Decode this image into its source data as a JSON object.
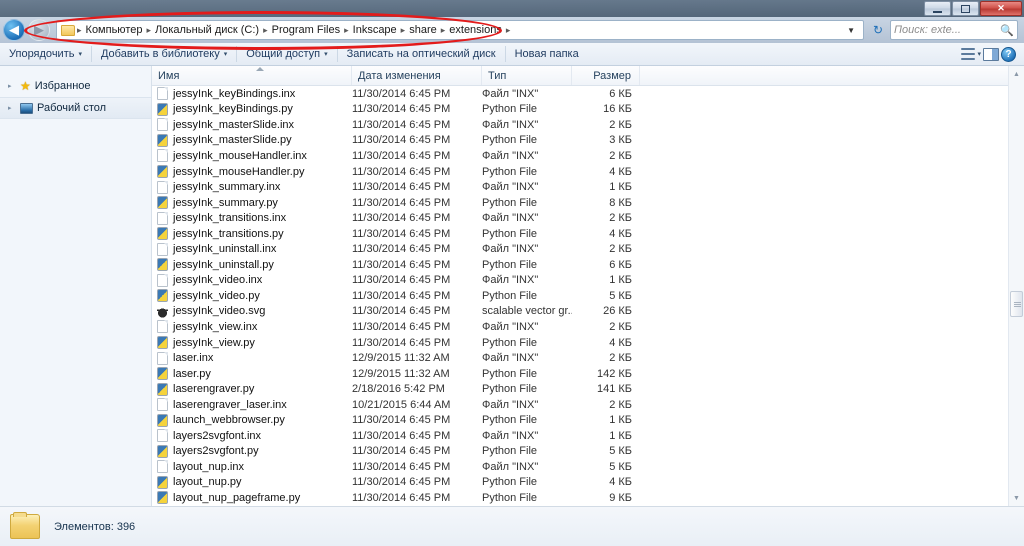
{
  "window": {
    "controls": {
      "minimize": "–",
      "maximize": "❐",
      "close": "✕"
    }
  },
  "address": {
    "back_label": "◀",
    "forward_label": "▶",
    "breadcrumbs": [
      "Компьютер",
      "Локальный диск (C:)",
      "Program Files",
      "Inkscape",
      "share",
      "extensions"
    ],
    "separator": "▸",
    "dropdown": "▼",
    "refresh": "↻"
  },
  "search": {
    "placeholder": "Поиск: exte...",
    "value": "",
    "icon": "search-icon"
  },
  "toolbar": {
    "organize": "Упорядочить",
    "add_to_library": "Добавить в библиотеку",
    "share": "Общий доступ",
    "burn": "Записать на оптический диск",
    "new_folder": "Новая папка",
    "caret": "▾",
    "help": "?"
  },
  "sidebar": {
    "items": [
      {
        "label": "Избранное",
        "icon": "star-icon",
        "expander": "▸"
      },
      {
        "label": "Рабочий стол",
        "icon": "desktop-icon",
        "expander": "▸"
      }
    ]
  },
  "columns": {
    "name": "Имя",
    "date": "Дата изменения",
    "type": "Тип",
    "size": "Размер"
  },
  "files": [
    {
      "name": "jessyInk_keyBindings.inx",
      "date": "11/30/2014 6:45 PM",
      "type": "Файл \"INX\"",
      "size": "6 КБ",
      "icon": "doc"
    },
    {
      "name": "jessyInk_keyBindings.py",
      "date": "11/30/2014 6:45 PM",
      "type": "Python File",
      "size": "16 КБ",
      "icon": "py"
    },
    {
      "name": "jessyInk_masterSlide.inx",
      "date": "11/30/2014 6:45 PM",
      "type": "Файл \"INX\"",
      "size": "2 КБ",
      "icon": "doc"
    },
    {
      "name": "jessyInk_masterSlide.py",
      "date": "11/30/2014 6:45 PM",
      "type": "Python File",
      "size": "3 КБ",
      "icon": "py"
    },
    {
      "name": "jessyInk_mouseHandler.inx",
      "date": "11/30/2014 6:45 PM",
      "type": "Файл \"INX\"",
      "size": "2 КБ",
      "icon": "doc"
    },
    {
      "name": "jessyInk_mouseHandler.py",
      "date": "11/30/2014 6:45 PM",
      "type": "Python File",
      "size": "4 КБ",
      "icon": "py"
    },
    {
      "name": "jessyInk_summary.inx",
      "date": "11/30/2014 6:45 PM",
      "type": "Файл \"INX\"",
      "size": "1 КБ",
      "icon": "doc"
    },
    {
      "name": "jessyInk_summary.py",
      "date": "11/30/2014 6:45 PM",
      "type": "Python File",
      "size": "8 КБ",
      "icon": "py"
    },
    {
      "name": "jessyInk_transitions.inx",
      "date": "11/30/2014 6:45 PM",
      "type": "Файл \"INX\"",
      "size": "2 КБ",
      "icon": "doc"
    },
    {
      "name": "jessyInk_transitions.py",
      "date": "11/30/2014 6:45 PM",
      "type": "Python File",
      "size": "4 КБ",
      "icon": "py"
    },
    {
      "name": "jessyInk_uninstall.inx",
      "date": "11/30/2014 6:45 PM",
      "type": "Файл \"INX\"",
      "size": "2 КБ",
      "icon": "doc"
    },
    {
      "name": "jessyInk_uninstall.py",
      "date": "11/30/2014 6:45 PM",
      "type": "Python File",
      "size": "6 КБ",
      "icon": "py"
    },
    {
      "name": "jessyInk_video.inx",
      "date": "11/30/2014 6:45 PM",
      "type": "Файл \"INX\"",
      "size": "1 КБ",
      "icon": "doc"
    },
    {
      "name": "jessyInk_video.py",
      "date": "11/30/2014 6:45 PM",
      "type": "Python File",
      "size": "5 КБ",
      "icon": "py"
    },
    {
      "name": "jessyInk_video.svg",
      "date": "11/30/2014 6:45 PM",
      "type": "scalable vector gr...",
      "size": "26 КБ",
      "icon": "svg"
    },
    {
      "name": "jessyInk_view.inx",
      "date": "11/30/2014 6:45 PM",
      "type": "Файл \"INX\"",
      "size": "2 КБ",
      "icon": "doc"
    },
    {
      "name": "jessyInk_view.py",
      "date": "11/30/2014 6:45 PM",
      "type": "Python File",
      "size": "4 КБ",
      "icon": "py"
    },
    {
      "name": "laser.inx",
      "date": "12/9/2015 11:32 AM",
      "type": "Файл \"INX\"",
      "size": "2 КБ",
      "icon": "doc"
    },
    {
      "name": "laser.py",
      "date": "12/9/2015 11:32 AM",
      "type": "Python File",
      "size": "142 КБ",
      "icon": "py"
    },
    {
      "name": "laserengraver.py",
      "date": "2/18/2016 5:42 PM",
      "type": "Python File",
      "size": "141 КБ",
      "icon": "py"
    },
    {
      "name": "laserengraver_laser.inx",
      "date": "10/21/2015 6:44 AM",
      "type": "Файл \"INX\"",
      "size": "2 КБ",
      "icon": "doc"
    },
    {
      "name": "launch_webbrowser.py",
      "date": "11/30/2014 6:45 PM",
      "type": "Python File",
      "size": "1 КБ",
      "icon": "py"
    },
    {
      "name": "layers2svgfont.inx",
      "date": "11/30/2014 6:45 PM",
      "type": "Файл \"INX\"",
      "size": "1 КБ",
      "icon": "doc"
    },
    {
      "name": "layers2svgfont.py",
      "date": "11/30/2014 6:45 PM",
      "type": "Python File",
      "size": "5 КБ",
      "icon": "py"
    },
    {
      "name": "layout_nup.inx",
      "date": "11/30/2014 6:45 PM",
      "type": "Файл \"INX\"",
      "size": "5 КБ",
      "icon": "doc"
    },
    {
      "name": "layout_nup.py",
      "date": "11/30/2014 6:45 PM",
      "type": "Python File",
      "size": "4 КБ",
      "icon": "py"
    },
    {
      "name": "layout_nup_pageframe.py",
      "date": "11/30/2014 6:45 PM",
      "type": "Python File",
      "size": "9 КБ",
      "icon": "py"
    }
  ],
  "status": {
    "text": "Элементов: 396",
    "icon": "folder-icon"
  },
  "annotation": {
    "shape": "ellipse",
    "color": "#e31b1b",
    "target": "address-bar"
  },
  "scrollbar": {
    "up": "▲",
    "down": "▼"
  }
}
